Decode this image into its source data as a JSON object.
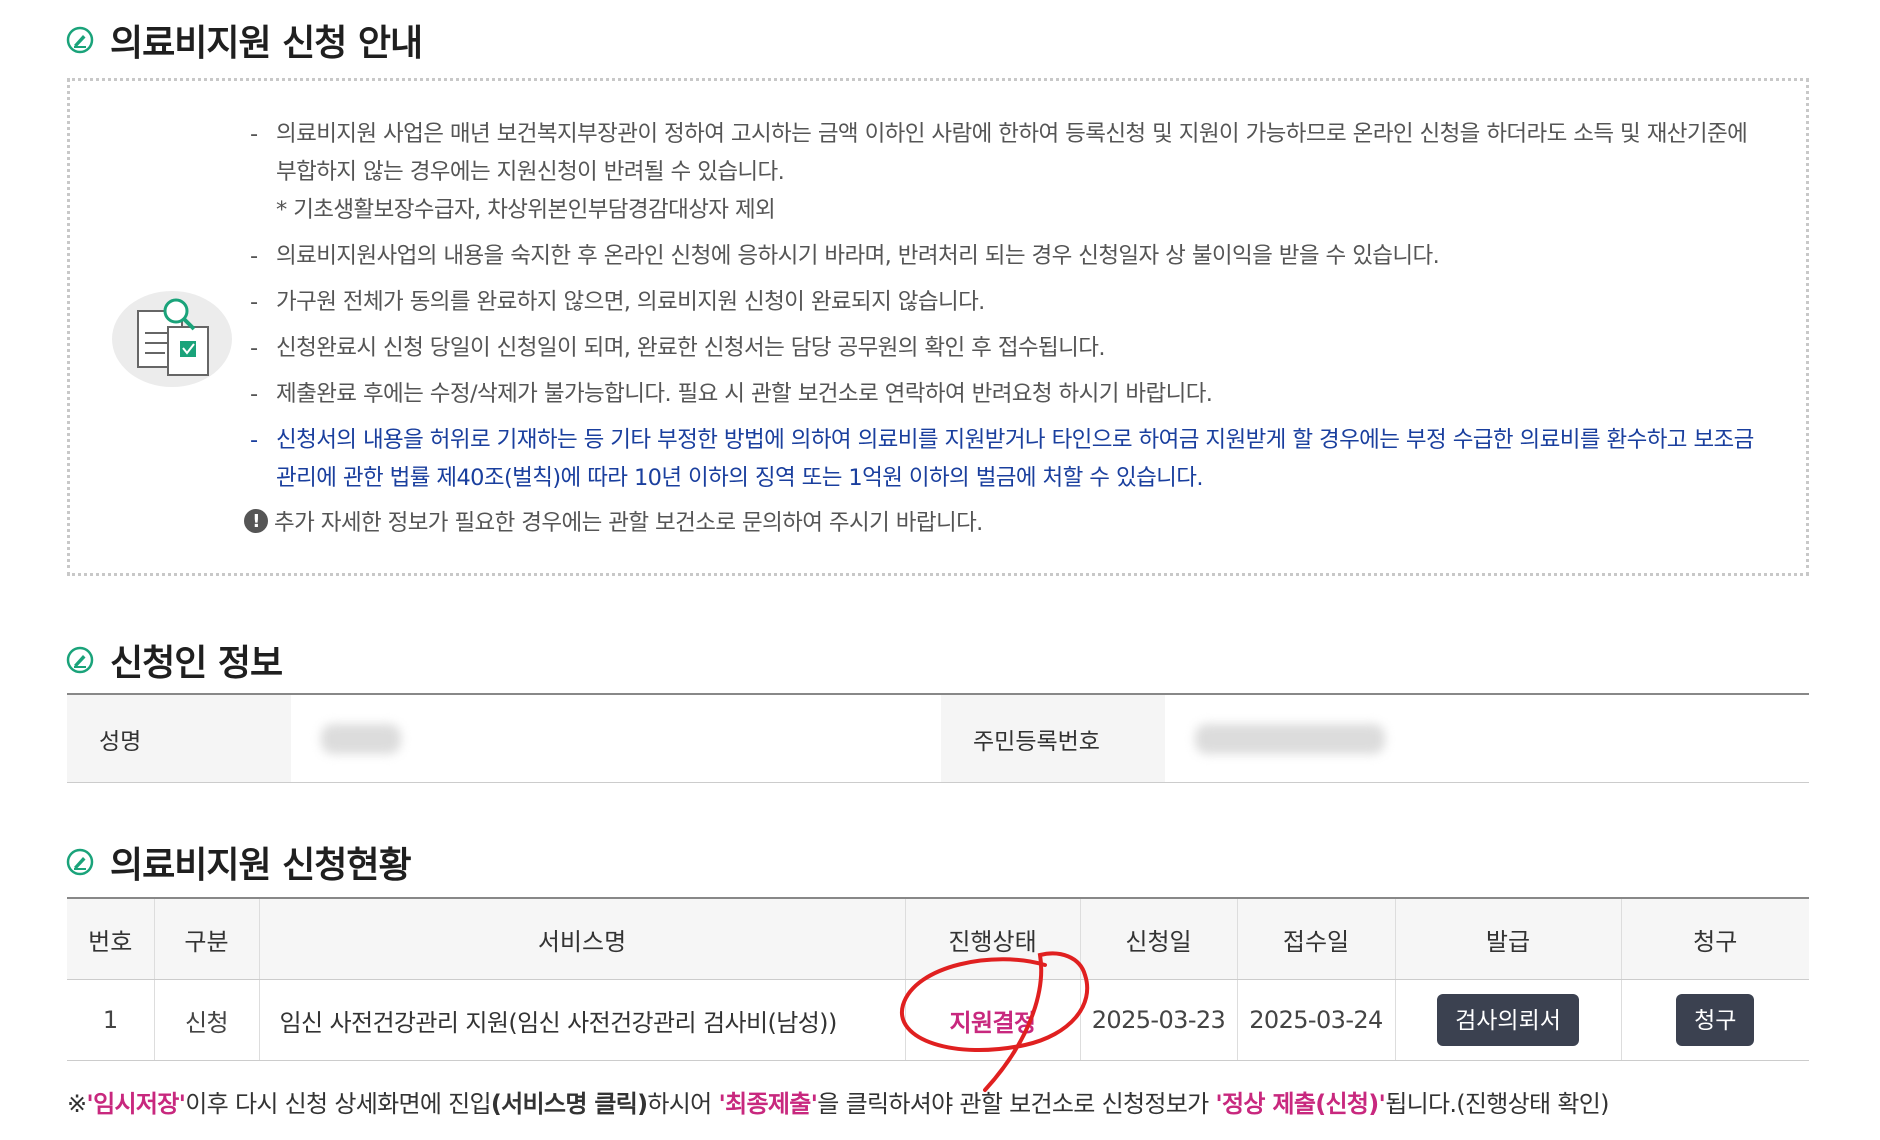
{
  "notice_section": {
    "title": "의료비지원 신청 안내",
    "items": [
      {
        "text": "의료비지원 사업은 매년 보건복지부장관이 정하여 고시하는 금액 이하인 사람에 한하여 등록신청 및 지원이 가능하므로 온라인 신청을 하더라도 소득 및 재산기준에 부합하지 않는 경우에는 지원신청이 반려될 수 있습니다.",
        "sub": "* 기초생활보장수급자, 차상위본인부담경감대상자 제외"
      },
      {
        "text": "의료비지원사업의 내용을 숙지한 후 온라인 신청에 응하시기 바라며, 반려처리 되는 경우 신청일자 상 불이익을 받을 수 있습니다."
      },
      {
        "text": "가구원 전체가 동의를 완료하지 않으면, 의료비지원 신청이 완료되지 않습니다."
      },
      {
        "text": "신청완료시 신청 당일이 신청일이 되며, 완료한 신청서는 담당 공무원의 확인 후 접수됩니다."
      },
      {
        "text": "제출완료 후에는 수정/삭제가 불가능합니다. 필요 시 관할 보건소로 연락하여 반려요청 하시기 바랍니다."
      },
      {
        "text": "신청서의 내용을 허위로 기재하는 등 기타 부정한 방법에 의하여 의료비를 지원받거나 타인으로 하여금 지원받게 할 경우에는 부정 수급한 의료비를 환수하고 보조금 관리에 관한 법률 제40조(벌칙)에 따라 10년 이하의 징역 또는 1억원 이하의 벌금에 처할 수 있습니다."
      }
    ],
    "info": "추가 자세한 정보가 필요한 경우에는 관할 보건소로 문의하여 주시기 바랍니다."
  },
  "applicant_section": {
    "title": "신청인 정보",
    "name_label": "성명",
    "id_label": "주민등록번호"
  },
  "status_section": {
    "title": "의료비지원 신청현황",
    "headers": [
      "번호",
      "구분",
      "서비스명",
      "진행상태",
      "신청일",
      "접수일",
      "발급",
      "청구"
    ],
    "rows": [
      {
        "no": "1",
        "type": "신청",
        "service": "임신 사전건강관리 지원(임신 사전건강관리 검사비(남성))",
        "state": "지원결정",
        "apply_date": "2025-03-23",
        "receipt_date": "2025-03-24",
        "issue_btn": "검사의뢰서",
        "claim_btn": "청구"
      }
    ]
  },
  "footnote": {
    "prefix": "※",
    "q1": "'임시저장'",
    "t1": "이후 다시 신청 상세화면에 진입",
    "b1": "(서비스명 클릭)",
    "t2": "하시어 ",
    "q2": "'최종제출'",
    "t3": "을 클릭하셔야 관할 보건소로 신청정보가 ",
    "q3": "'정상 제출(신청)'",
    "t4": "됩니다.(진행상태 확인)"
  },
  "colors": {
    "accent_pink": "#c8287e",
    "warn_blue": "#1a3f9e",
    "icon_green": "#1aa37a",
    "button_dark": "#3b4150",
    "annotation_red": "#e02020"
  },
  "icons": [
    "pencil-circle-icon",
    "document-search-icon",
    "exclamation-circle-icon"
  ]
}
